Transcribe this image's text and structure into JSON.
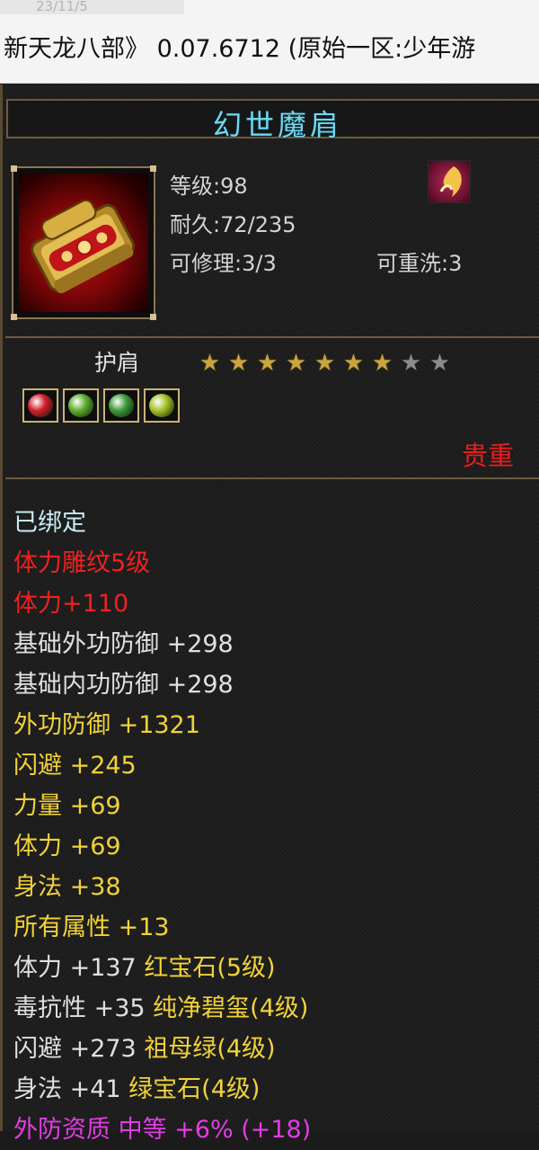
{
  "window": {
    "ghost_title": "23/11/5",
    "title": "新天龙八部》 0.07.6712 (原始一区:少年游"
  },
  "item": {
    "name": "幻世魔肩",
    "level_label": "等级:98",
    "durability_label": "耐久:72/235",
    "repair_label": "可修理:3/3",
    "reforge_label": "可重洗:3",
    "type": "护肩",
    "stars_total": 9,
    "stars_filled": 7,
    "quality": "贵重",
    "gems": [
      {
        "icon": "red-gem-icon",
        "color": "#d21c2c"
      },
      {
        "icon": "green-gem-icon",
        "color": "#5fae2f"
      },
      {
        "icon": "green-gem-icon",
        "color": "#3e9a3a"
      },
      {
        "icon": "yellow-green-gem-icon",
        "color": "#a7c02a"
      }
    ]
  },
  "attributes": [
    {
      "text": "已绑定",
      "color": "bound"
    },
    {
      "text": "体力雕纹5级",
      "color": "red"
    },
    {
      "text": "体力+110",
      "color": "red"
    },
    {
      "text": "基础外功防御 +298",
      "color": "white"
    },
    {
      "text": "基础内功防御 +298",
      "color": "white"
    },
    {
      "text": "外功防御 +1321",
      "color": "yellow"
    },
    {
      "text": "闪避 +245",
      "color": "yellow"
    },
    {
      "text": "力量 +69",
      "color": "yellow"
    },
    {
      "text": "体力 +69",
      "color": "yellow"
    },
    {
      "text": "身法 +38",
      "color": "yellow"
    },
    {
      "text": "所有属性 +13",
      "color": "yellow"
    }
  ],
  "gem_attributes": [
    {
      "stat": "体力 +137",
      "gem": "红宝石(5级)"
    },
    {
      "stat": "毒抗性 +35",
      "gem": "纯净碧玺(4级)"
    },
    {
      "stat": "闪避 +273",
      "gem": "祖母绿(4级)"
    },
    {
      "stat": "身法 +41",
      "gem": "绿宝石(4级)"
    }
  ],
  "partial_line": "外防资质 中等 +6% (+18)",
  "colors": {
    "name": "#6fd8ee",
    "quality": "#ee1d1d",
    "frame": "#6d5b3f"
  }
}
